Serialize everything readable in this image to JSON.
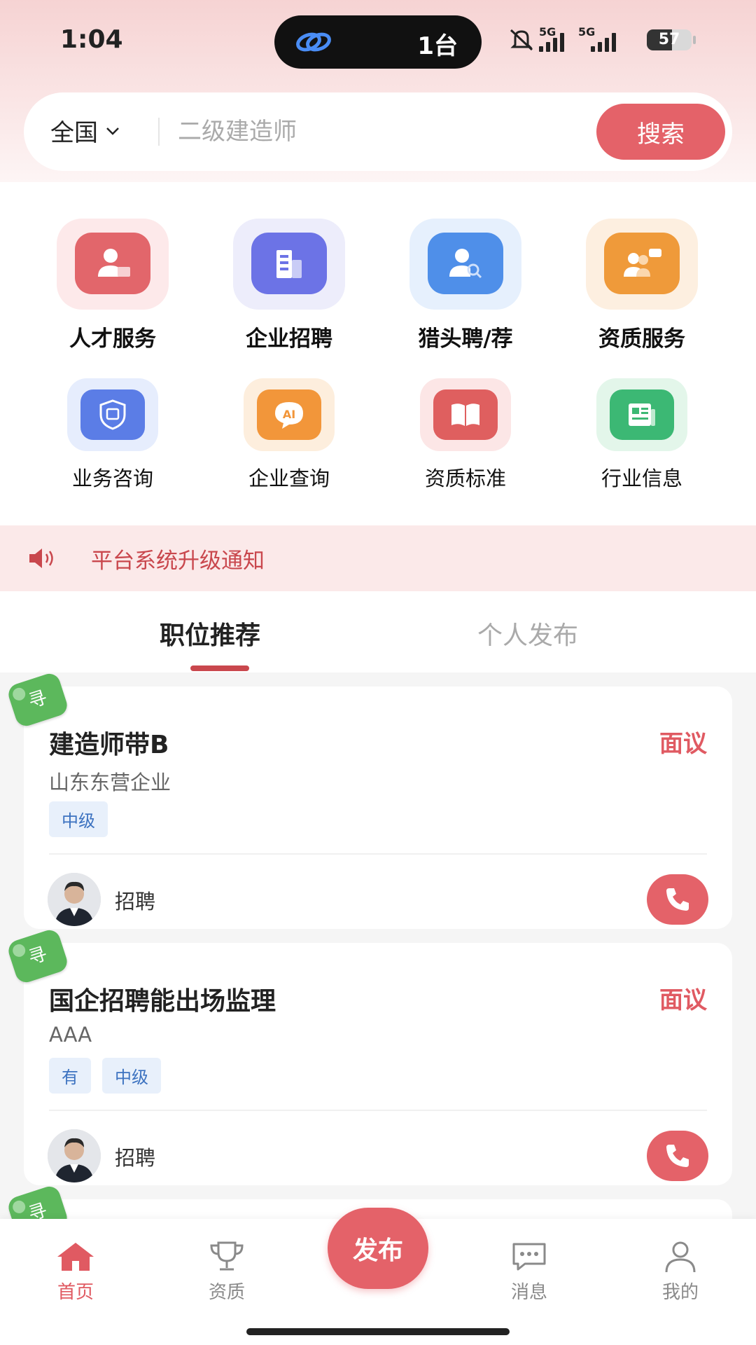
{
  "status_bar": {
    "time": "1:04",
    "island_text": "1台",
    "signal_labels": [
      "5G",
      "5G"
    ],
    "battery": "57",
    "battery_level": 0.57
  },
  "search": {
    "region": "全国",
    "placeholder": "二级建造师",
    "button": "搜索"
  },
  "services": {
    "row1": [
      {
        "label": "人才服务",
        "icon": "person-card-icon",
        "color": "#e2666b",
        "tile": "#fde9ea"
      },
      {
        "label": "企业招聘",
        "icon": "building-icon",
        "color": "#6c73e6",
        "tile": "#ededfb"
      },
      {
        "label": "猎头聘/荐",
        "icon": "person-search-icon",
        "color": "#4f8fe9",
        "tile": "#e6f0fd"
      },
      {
        "label": "资质服务",
        "icon": "people-chat-icon",
        "color": "#ef9a3a",
        "tile": "#fdefe0"
      }
    ],
    "row2": [
      {
        "label": "业务咨询",
        "icon": "shield-doc-icon",
        "color": "#5b7de6",
        "tile": "#e6edfd"
      },
      {
        "label": "企业查询",
        "icon": "ai-chat-icon",
        "color": "#f2963a",
        "tile": "#fdeedd"
      },
      {
        "label": "资质标准",
        "icon": "book-icon",
        "color": "#df5f5f",
        "tile": "#fce6e6"
      },
      {
        "label": "行业信息",
        "icon": "newspaper-icon",
        "color": "#3cb874",
        "tile": "#e3f6ea"
      }
    ]
  },
  "notice": {
    "text": "平台系统升级通知"
  },
  "tabs": {
    "active": "职位推荐",
    "inactive": "个人发布"
  },
  "jobs": [
    {
      "badge": "寻",
      "title": "建造师带B",
      "salary": "面议",
      "company": "山东东营企业",
      "tags": [
        "中级"
      ],
      "poster": "招聘"
    },
    {
      "badge": "寻",
      "title": "国企招聘能出场监理",
      "salary": "面议",
      "company": "AAA",
      "tags": [
        "有",
        "中级"
      ],
      "poster": "招聘"
    }
  ],
  "partial_badge": "寻",
  "tabbar": {
    "home": "首页",
    "qualification": "资质",
    "publish": "发布",
    "messages": "消息",
    "mine": "我的"
  },
  "colors": {
    "accent": "#e46269",
    "tag_bg": "#e8f0fb",
    "tag_text": "#3c72c0",
    "badge": "#5cb85c"
  }
}
